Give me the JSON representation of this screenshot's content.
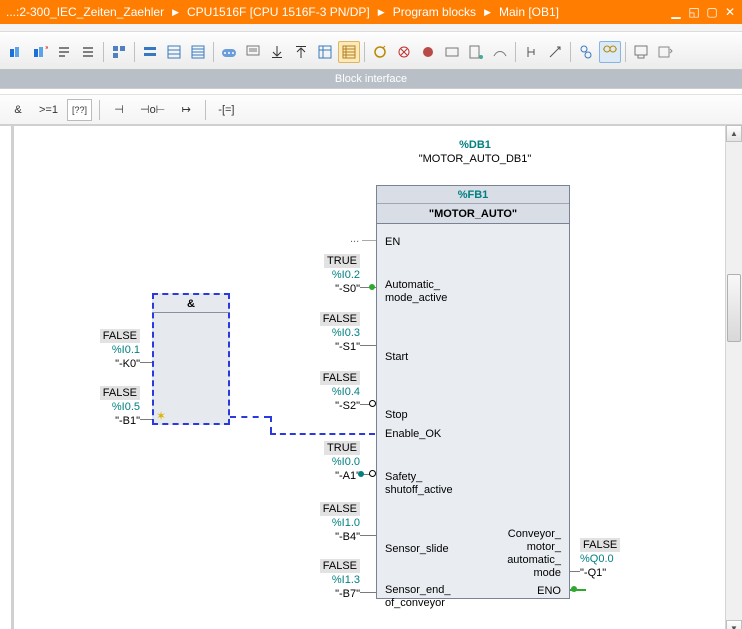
{
  "title": {
    "bc1": "...:2-300_IEC_Zeiten_Zaehler",
    "bc2": "CPU1516F [CPU 1516F-3 PN/DP]",
    "bc3": "Program blocks",
    "bc4": "Main [OB1]"
  },
  "interface_label": "Block interface",
  "fbd": {
    "b1": "&",
    "b2": ">=1",
    "b3": "[??]",
    "b4": "⊣",
    "b5": "⊣o⊢",
    "b6": "↦",
    "b7": "-[=]"
  },
  "db": {
    "addr": "%DB1",
    "name": "\"MOTOR_AUTO_DB1\""
  },
  "fb": {
    "title": "%FB1",
    "name": "\"MOTOR_AUTO\""
  },
  "and": {
    "title": "&"
  },
  "and_in1": {
    "val": "FALSE",
    "addr": "%I0.1",
    "name": "\"-K0\""
  },
  "and_in2": {
    "val": "FALSE",
    "addr": "%I0.5",
    "name": "\"-B1\""
  },
  "pins": {
    "en": "EN",
    "auto": "Automatic_mode_active",
    "start": "Start",
    "stop": "Stop",
    "enok": "Enable_OK",
    "safety": "Safety_shutoff_active",
    "slide": "Sensor_slide",
    "send": "Sensor_end_of_conveyor",
    "out": "Conveyor_motor_automatic_mode",
    "eno": "ENO"
  },
  "p_auto": {
    "val": "TRUE",
    "addr": "%I0.2",
    "name": "\"-S0\""
  },
  "p_start": {
    "val": "FALSE",
    "addr": "%I0.3",
    "name": "\"-S1\""
  },
  "p_stop": {
    "val": "FALSE",
    "addr": "%I0.4",
    "name": "\"-S2\""
  },
  "p_safety": {
    "val": "TRUE",
    "addr": "%I0.0",
    "name": "\"-A1\""
  },
  "p_slide": {
    "val": "FALSE",
    "addr": "%I1.0",
    "name": "\"-B4\""
  },
  "p_send": {
    "val": "FALSE",
    "addr": "%I1.3",
    "name": "\"-B7\""
  },
  "p_out": {
    "val": "FALSE",
    "addr": "%Q0.0",
    "name": "\"-Q1\""
  },
  "dots": "..."
}
